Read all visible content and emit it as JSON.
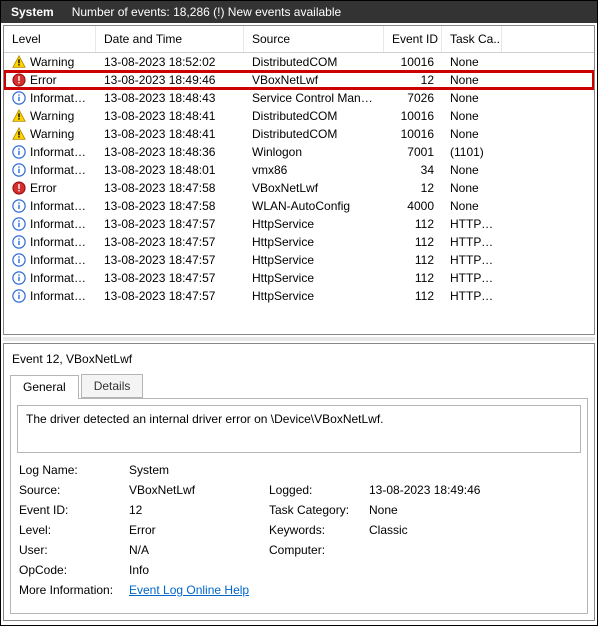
{
  "titlebar": {
    "system": "System",
    "status": "Number of events: 18,286 (!) New events available"
  },
  "columns": {
    "level": "Level",
    "datetime": "Date and Time",
    "source": "Source",
    "eventid": "Event ID",
    "taskcat": "Task Ca..."
  },
  "rows": [
    {
      "icon": "warn",
      "level": "Warning",
      "dt": "13-08-2023 18:52:02",
      "src": "DistributedCOM",
      "eid": "10016",
      "cat": "None",
      "hl": false
    },
    {
      "icon": "err",
      "level": "Error",
      "dt": "13-08-2023 18:49:46",
      "src": "VBoxNetLwf",
      "eid": "12",
      "cat": "None",
      "hl": true
    },
    {
      "icon": "info",
      "level": "Information",
      "dt": "13-08-2023 18:48:43",
      "src": "Service Control Mana...",
      "eid": "7026",
      "cat": "None",
      "hl": false
    },
    {
      "icon": "warn",
      "level": "Warning",
      "dt": "13-08-2023 18:48:41",
      "src": "DistributedCOM",
      "eid": "10016",
      "cat": "None",
      "hl": false
    },
    {
      "icon": "warn",
      "level": "Warning",
      "dt": "13-08-2023 18:48:41",
      "src": "DistributedCOM",
      "eid": "10016",
      "cat": "None",
      "hl": false
    },
    {
      "icon": "info",
      "level": "Information",
      "dt": "13-08-2023 18:48:36",
      "src": "Winlogon",
      "eid": "7001",
      "cat": "(1101)",
      "hl": false
    },
    {
      "icon": "info",
      "level": "Information",
      "dt": "13-08-2023 18:48:01",
      "src": "vmx86",
      "eid": "34",
      "cat": "None",
      "hl": false
    },
    {
      "icon": "err",
      "level": "Error",
      "dt": "13-08-2023 18:47:58",
      "src": "VBoxNetLwf",
      "eid": "12",
      "cat": "None",
      "hl": false
    },
    {
      "icon": "info",
      "level": "Information",
      "dt": "13-08-2023 18:47:58",
      "src": "WLAN-AutoConfig",
      "eid": "4000",
      "cat": "None",
      "hl": false
    },
    {
      "icon": "info",
      "level": "Information",
      "dt": "13-08-2023 18:47:57",
      "src": "HttpService",
      "eid": "112",
      "cat": "HTTP S...",
      "hl": false
    },
    {
      "icon": "info",
      "level": "Information",
      "dt": "13-08-2023 18:47:57",
      "src": "HttpService",
      "eid": "112",
      "cat": "HTTP S...",
      "hl": false
    },
    {
      "icon": "info",
      "level": "Information",
      "dt": "13-08-2023 18:47:57",
      "src": "HttpService",
      "eid": "112",
      "cat": "HTTP S...",
      "hl": false
    },
    {
      "icon": "info",
      "level": "Information",
      "dt": "13-08-2023 18:47:57",
      "src": "HttpService",
      "eid": "112",
      "cat": "HTTP S...",
      "hl": false
    },
    {
      "icon": "info",
      "level": "Information",
      "dt": "13-08-2023 18:47:57",
      "src": "HttpService",
      "eid": "112",
      "cat": "HTTP S...",
      "hl": false
    }
  ],
  "details": {
    "title": "Event 12, VBoxNetLwf",
    "tabs": {
      "general": "General",
      "details": "Details"
    },
    "message": "The driver detected an internal driver error on \\Device\\VBoxNetLwf.",
    "labels": {
      "logname": "Log Name:",
      "source": "Source:",
      "eventid": "Event ID:",
      "level": "Level:",
      "user": "User:",
      "opcode": "OpCode:",
      "moreinfo": "More Information:",
      "logged": "Logged:",
      "taskcat": "Task Category:",
      "keywords": "Keywords:",
      "computer": "Computer:"
    },
    "values": {
      "logname": "System",
      "source": "VBoxNetLwf",
      "eventid": "12",
      "level": "Error",
      "user": "N/A",
      "opcode": "Info",
      "moreinfo": "Event Log Online Help",
      "logged": "13-08-2023 18:49:46",
      "taskcat": "None",
      "keywords": "Classic",
      "computer": ""
    }
  }
}
